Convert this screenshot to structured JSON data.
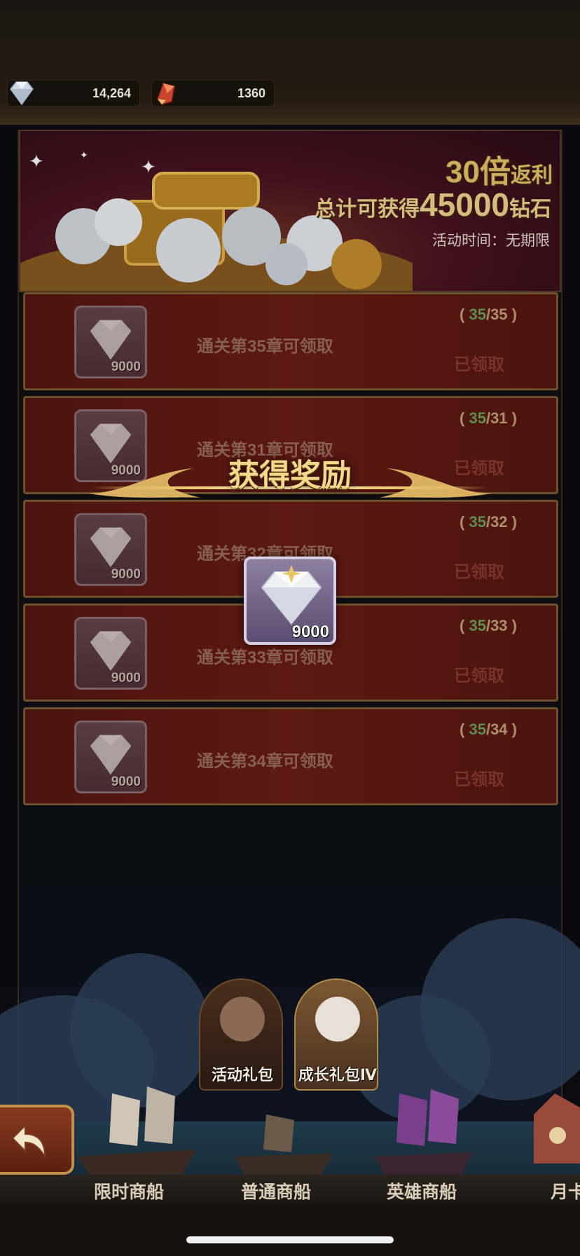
{
  "resources": [
    {
      "icon": "diamond-icon",
      "value": "14,264"
    },
    {
      "icon": "red-crystal-icon",
      "value": "1360"
    }
  ],
  "banner": {
    "multiplier_num": "30",
    "multiplier_text": "倍",
    "multiplier_suffix": "返利",
    "total_prefix": "总计可获得",
    "total_amount": "45000",
    "total_suffix": "钻石",
    "time_text": "活动时间：无期限"
  },
  "rewards": [
    {
      "amount": "9000",
      "desc": "通关第35章可领取",
      "progress_cur": "35",
      "progress_req": "35",
      "status": "已领取"
    },
    {
      "amount": "9000",
      "desc": "通关第31章可领取",
      "progress_cur": "35",
      "progress_req": "31",
      "status": "已领取"
    },
    {
      "amount": "9000",
      "desc": "通关第32章可领取",
      "progress_cur": "35",
      "progress_req": "32",
      "status": "已领取"
    },
    {
      "amount": "9000",
      "desc": "通关第33章可领取",
      "progress_cur": "35",
      "progress_req": "33",
      "status": "已领取"
    },
    {
      "amount": "9000",
      "desc": "通关第34章可领取",
      "progress_cur": "35",
      "progress_req": "34",
      "status": "已领取"
    }
  ],
  "popup": {
    "title": "获得奖励",
    "item_amount": "9000",
    "item_icon": "diamond-icon"
  },
  "packs": [
    {
      "label": "活动礼包"
    },
    {
      "label": "成长礼包Ⅳ"
    }
  ],
  "tabs": [
    "限时商船",
    "普通商船",
    "英雄商船",
    "月卡"
  ],
  "colors": {
    "gold": "#e9c56a",
    "banner_red": "#4b1420",
    "row_red": "#6a1d14"
  }
}
